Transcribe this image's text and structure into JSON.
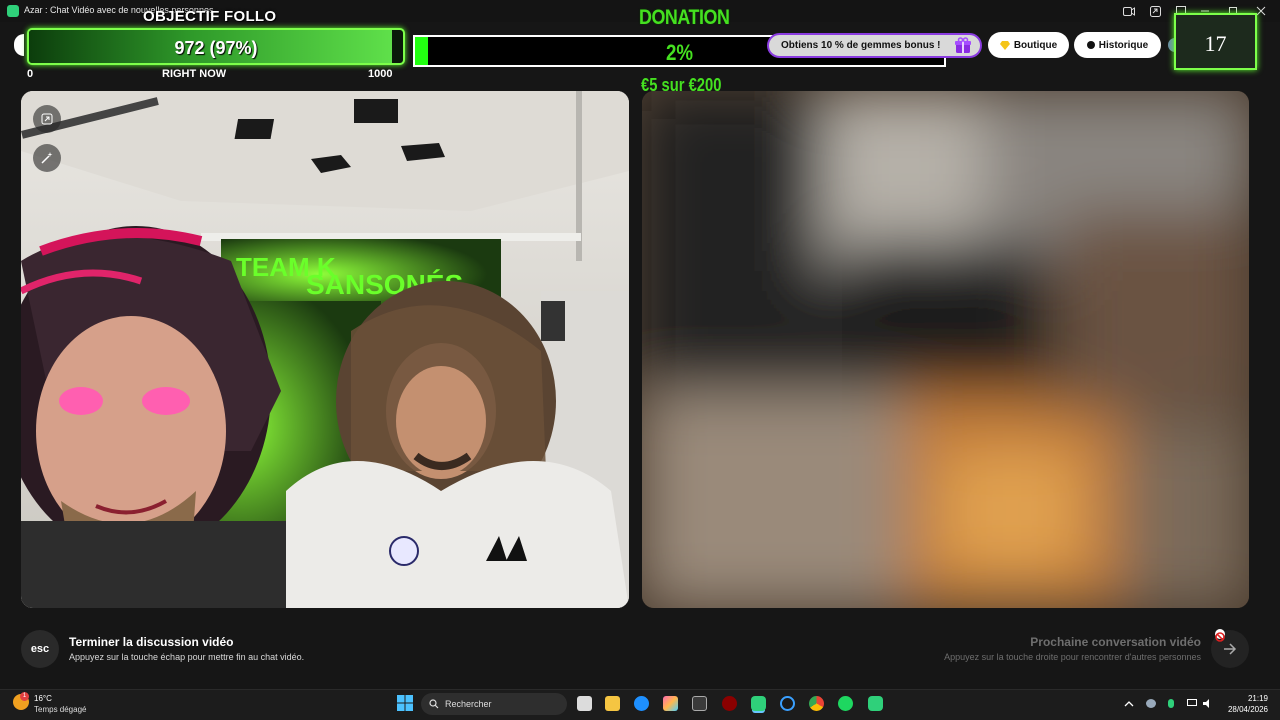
{
  "window": {
    "title": "Azar : Chat Vidéo avec de nouvelles personnes"
  },
  "goal": {
    "title": "OBJECTIF FOLLO",
    "value_text": "972 (97%)",
    "progress": 0.97,
    "min_label": "0",
    "mid_label": "RIGHT NOW",
    "max_label": "1000",
    "accent": "#7dff4a"
  },
  "donation": {
    "title": "DONATION",
    "percent_text": "2%",
    "progress": 0.02,
    "amount_text": "€5 sur €200",
    "accent": "#45e020"
  },
  "header": {
    "bonus_text": "Obtiens 10 % de gemmes bonus !",
    "shop_label": "Boutique",
    "history_label": "Historique",
    "counter": "17"
  },
  "footer": {
    "esc_label": "esc",
    "end_title": "Terminer la discussion vidéo",
    "end_sub": "Appuyez sur la touche échap pour mettre fin au chat vidéo.",
    "next_title": "Prochaine conversation vidéo",
    "next_sub": "Appuyez sur la touche droite pour rencontrer d'autres personnes"
  },
  "taskbar": {
    "weather_temp": "16°C",
    "weather_desc": "Temps dégagé",
    "weather_badge": "1",
    "search_placeholder": "Rechercher",
    "time": "21:19",
    "date": "28/04/2026"
  },
  "video_banner": {
    "line1": "TEAM K",
    "line2": "SANSONÉS"
  },
  "icons": [
    "app-icon",
    "camera-icon",
    "share-icon",
    "minimize-icon",
    "maximize-icon",
    "close-icon",
    "gift-icon",
    "gem-icon",
    "clock-icon",
    "globe-icon",
    "expand-icon",
    "magic-wand-icon",
    "arrow-right-icon",
    "block-icon",
    "windows-start-icon",
    "search-icon"
  ]
}
